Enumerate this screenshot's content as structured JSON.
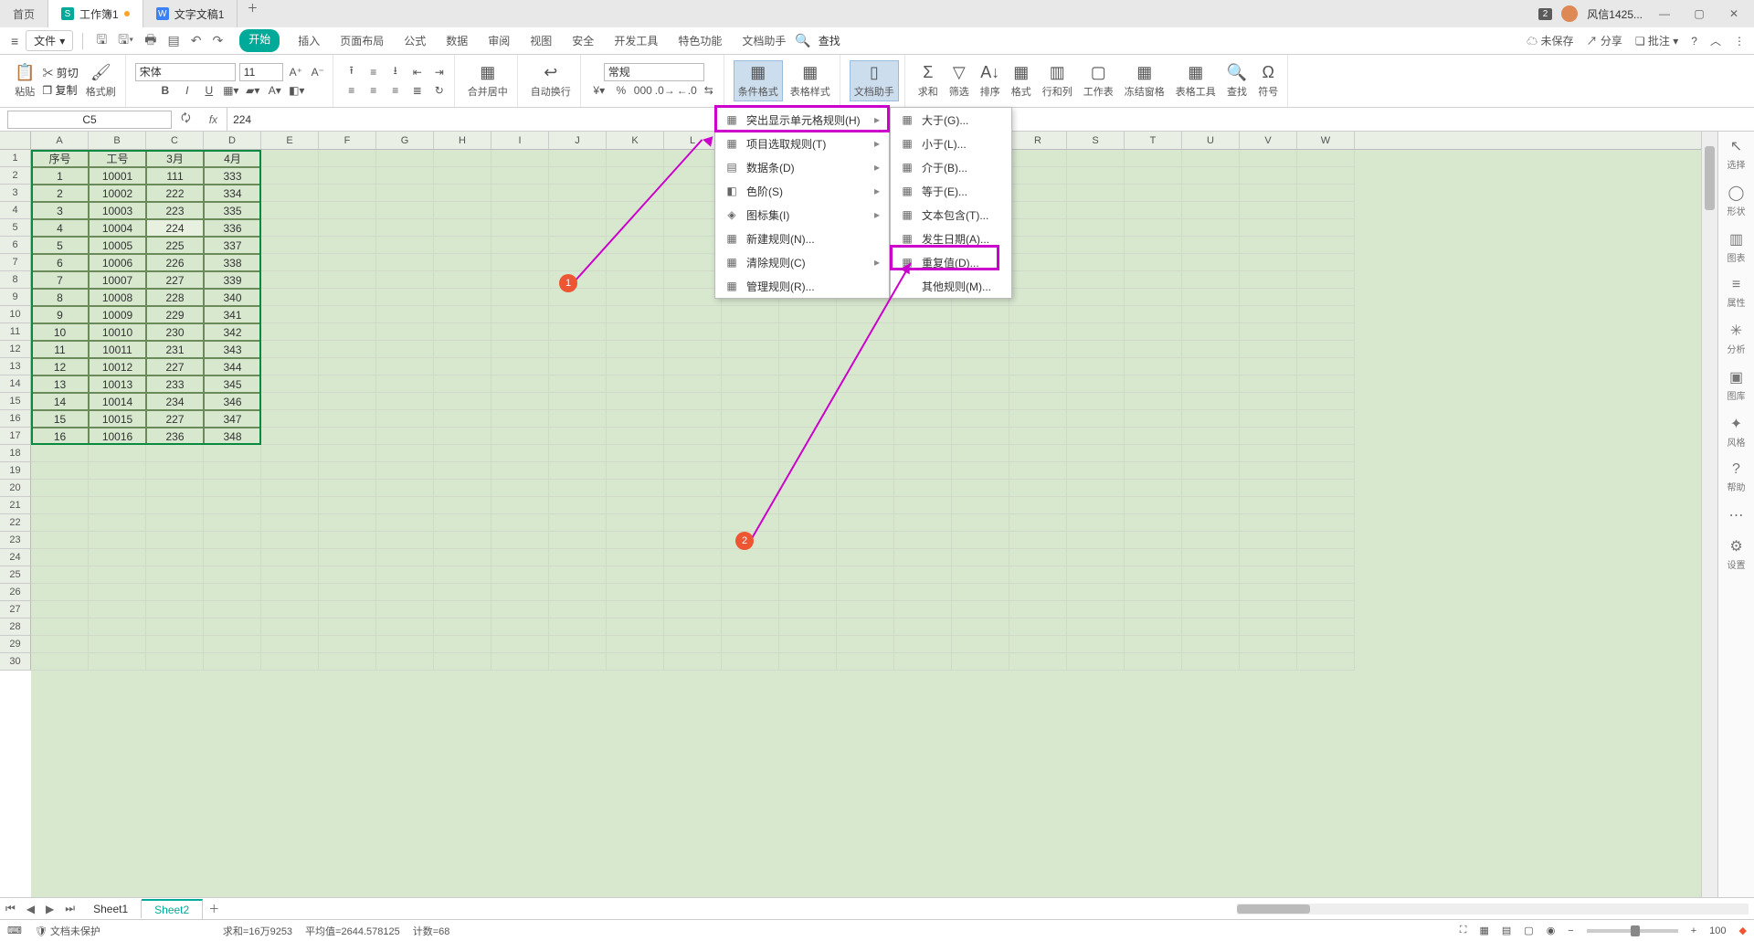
{
  "tabs": {
    "home": "首页",
    "workbook": "工作簿1",
    "worddoc": "文字文稿1",
    "notif_count": "2",
    "user": "风信1425..."
  },
  "menu": {
    "file": "文件",
    "items": [
      "开始",
      "插入",
      "页面布局",
      "公式",
      "数据",
      "审阅",
      "视图",
      "安全",
      "开发工具",
      "特色功能",
      "文档助手"
    ],
    "search": "查找"
  },
  "menubar_right": {
    "unsaved": "未保存",
    "share": "分享",
    "comment": "批注"
  },
  "ribbon": {
    "paste": "粘贴",
    "copy": "复制",
    "cut": "剪切",
    "fmtpaint": "格式刷",
    "font": "宋体",
    "size": "11",
    "merge": "合并居中",
    "wrap": "自动换行",
    "general": "常规",
    "condfmt": "条件格式",
    "tblfmt": "表格样式",
    "dochelper": "文档助手",
    "sum": "求和",
    "filter": "筛选",
    "sort": "排序",
    "format": "格式",
    "rowcol": "行和列",
    "sheet": "工作表",
    "freeze": "冻结窗格",
    "tbltools": "表格工具",
    "find": "查找",
    "symbol": "符号"
  },
  "fx": {
    "cell": "C5",
    "value": "224"
  },
  "cols": [
    "A",
    "B",
    "C",
    "D",
    "E",
    "F",
    "G",
    "H",
    "I",
    "J",
    "K",
    "L",
    "M",
    "N",
    "O",
    "P",
    "Q",
    "R",
    "S",
    "T",
    "U",
    "V",
    "W"
  ],
  "rows": 30,
  "table": {
    "headers": [
      "序号",
      "工号",
      "3月",
      "4月"
    ],
    "data": [
      [
        "1",
        "10001",
        "111",
        "333"
      ],
      [
        "2",
        "10002",
        "222",
        "334"
      ],
      [
        "3",
        "10003",
        "223",
        "335"
      ],
      [
        "4",
        "10004",
        "224",
        "336"
      ],
      [
        "5",
        "10005",
        "225",
        "337"
      ],
      [
        "6",
        "10006",
        "226",
        "338"
      ],
      [
        "7",
        "10007",
        "227",
        "339"
      ],
      [
        "8",
        "10008",
        "228",
        "340"
      ],
      [
        "9",
        "10009",
        "229",
        "341"
      ],
      [
        "10",
        "10010",
        "230",
        "342"
      ],
      [
        "11",
        "10011",
        "231",
        "343"
      ],
      [
        "12",
        "10012",
        "227",
        "344"
      ],
      [
        "13",
        "10013",
        "233",
        "345"
      ],
      [
        "14",
        "10014",
        "234",
        "346"
      ],
      [
        "15",
        "10015",
        "227",
        "347"
      ],
      [
        "16",
        "10016",
        "236",
        "348"
      ]
    ]
  },
  "dropdown1": [
    {
      "icon": "▦",
      "label": "突出显示单元格规则(H)",
      "arrow": true
    },
    {
      "icon": "▦",
      "label": "项目选取规则(T)",
      "arrow": true
    },
    {
      "icon": "▤",
      "label": "数据条(D)",
      "arrow": true
    },
    {
      "icon": "◧",
      "label": "色阶(S)",
      "arrow": true
    },
    {
      "icon": "◈",
      "label": "图标集(I)",
      "arrow": true
    },
    {
      "icon": "▦",
      "label": "新建规则(N)..."
    },
    {
      "icon": "▦",
      "label": "清除规则(C)",
      "arrow": true
    },
    {
      "icon": "▦",
      "label": "管理规则(R)..."
    }
  ],
  "dropdown2": [
    {
      "icon": "▦",
      "label": "大于(G)..."
    },
    {
      "icon": "▦",
      "label": "小于(L)..."
    },
    {
      "icon": "▦",
      "label": "介于(B)..."
    },
    {
      "icon": "▦",
      "label": "等于(E)..."
    },
    {
      "icon": "▦",
      "label": "文本包含(T)..."
    },
    {
      "icon": "▦",
      "label": "发生日期(A)..."
    },
    {
      "icon": "▦",
      "label": "重复值(D)..."
    },
    {
      "icon": "",
      "label": "其他规则(M)..."
    }
  ],
  "side": [
    {
      "g": "↖",
      "t": "选择"
    },
    {
      "g": "◯",
      "t": "形状"
    },
    {
      "g": "▥",
      "t": "图表"
    },
    {
      "g": "≡",
      "t": "属性"
    },
    {
      "g": "✳",
      "t": "分析"
    },
    {
      "g": "▣",
      "t": "图库"
    },
    {
      "g": "✦",
      "t": "风格"
    },
    {
      "g": "?",
      "t": "帮助"
    },
    {
      "g": "⋯",
      "t": ""
    },
    {
      "g": "⚙",
      "t": "设置"
    }
  ],
  "sheets": {
    "s1": "Sheet1",
    "s2": "Sheet2"
  },
  "status": {
    "protect": "文档未保护",
    "sum": "求和=16万9253",
    "avg": "平均值=2644.578125",
    "count": "计数=68",
    "zoom": "100"
  }
}
